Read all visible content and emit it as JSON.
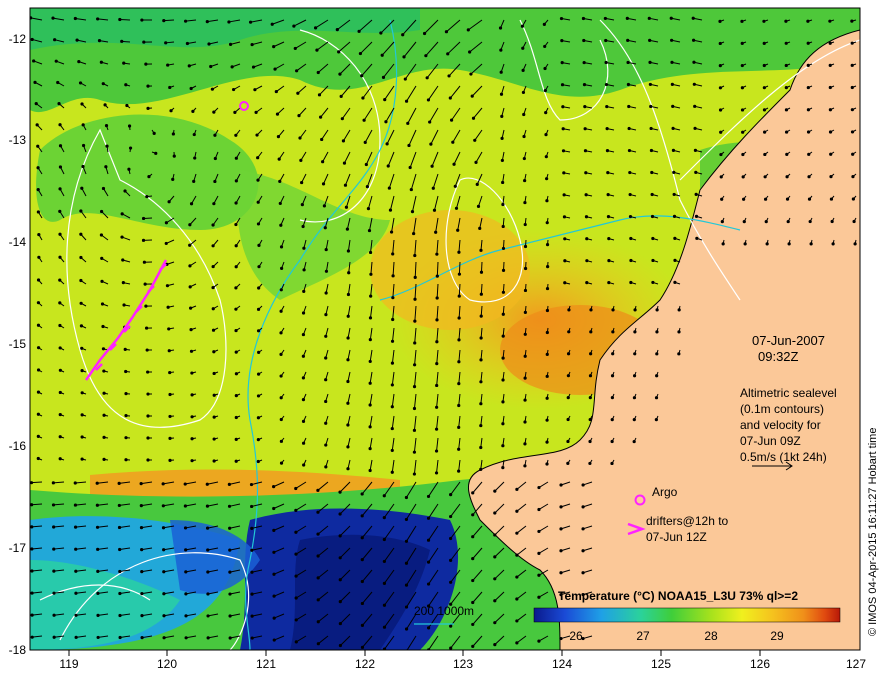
{
  "map": {
    "lon_ticks": [
      "119",
      "120",
      "121",
      "122",
      "123",
      "124",
      "125",
      "126",
      "127"
    ],
    "lat_ticks": [
      "-12",
      "-13",
      "-14",
      "-15",
      "-16",
      "-17",
      "-18"
    ]
  },
  "annotation": {
    "date": "07-Jun-2007",
    "time": "09:32Z",
    "desc_lines": [
      "Altimetric sealevel",
      "(0.1m contours)",
      "and velocity for",
      "07-Jun 09Z",
      "0.5m/s (1kt 24h)"
    ]
  },
  "legend": {
    "argo_label": "Argo",
    "drifter_line1": "drifters@12h to",
    "drifter_line2": "07-Jun 12Z",
    "bathy_label": "200  1000m"
  },
  "colorbar": {
    "title": "Temperature (°C) NOAA15_L3U 73% ql>=2",
    "ticks": [
      "26",
      "27",
      "28",
      "29"
    ],
    "colors": [
      "#0a1a8c",
      "#1a4ad6",
      "#1fa0e6",
      "#2bd29a",
      "#3fce3a",
      "#a8e21c",
      "#f0f01e",
      "#f5c21e",
      "#f0901a",
      "#e04a10",
      "#b81808"
    ]
  },
  "credit": "© IMOS 04-Apr-2015 16:11:27 Hobart time"
}
